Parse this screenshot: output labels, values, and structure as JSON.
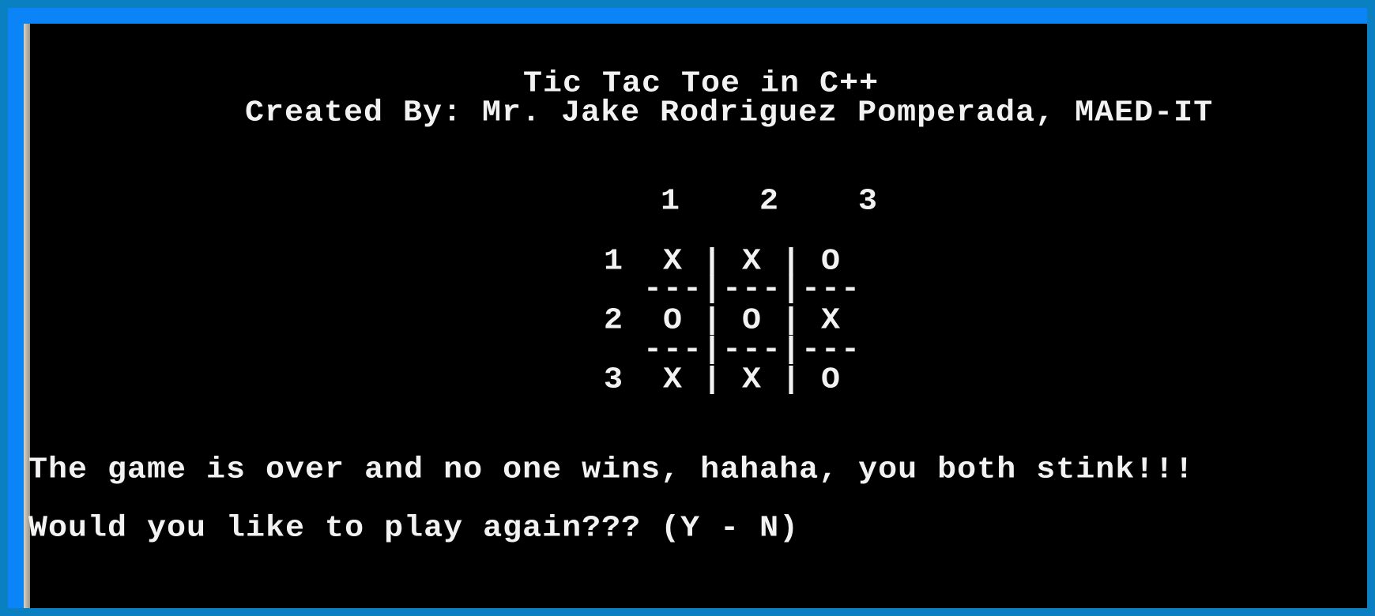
{
  "window": {
    "type": "console",
    "colors": {
      "background": "#000000",
      "text": "#f2f2f2",
      "frame": "#0a84f6"
    }
  },
  "header": {
    "title": "Tic Tac Toe in C++",
    "author": "Created By: Mr. Jake Rodriguez Pomperada, MAED-IT"
  },
  "board": {
    "column_header": "1    2    3",
    "rows": [
      {
        "label": "1",
        "cells": [
          "X",
          "X",
          "O"
        ]
      },
      {
        "label": "2",
        "cells": [
          "O",
          "O",
          "X"
        ]
      },
      {
        "label": "3",
        "cells": [
          "X",
          "X",
          "O"
        ]
      }
    ],
    "separator": "  ---|---|---",
    "row_text": [
      "1  X | X | O",
      "2  O | O | X",
      "3  X | X | O"
    ]
  },
  "status": {
    "message": "The game is over and no one wins, hahaha, you both stink!!!",
    "prompt": "Would you like to play again??? (Y - N)"
  }
}
